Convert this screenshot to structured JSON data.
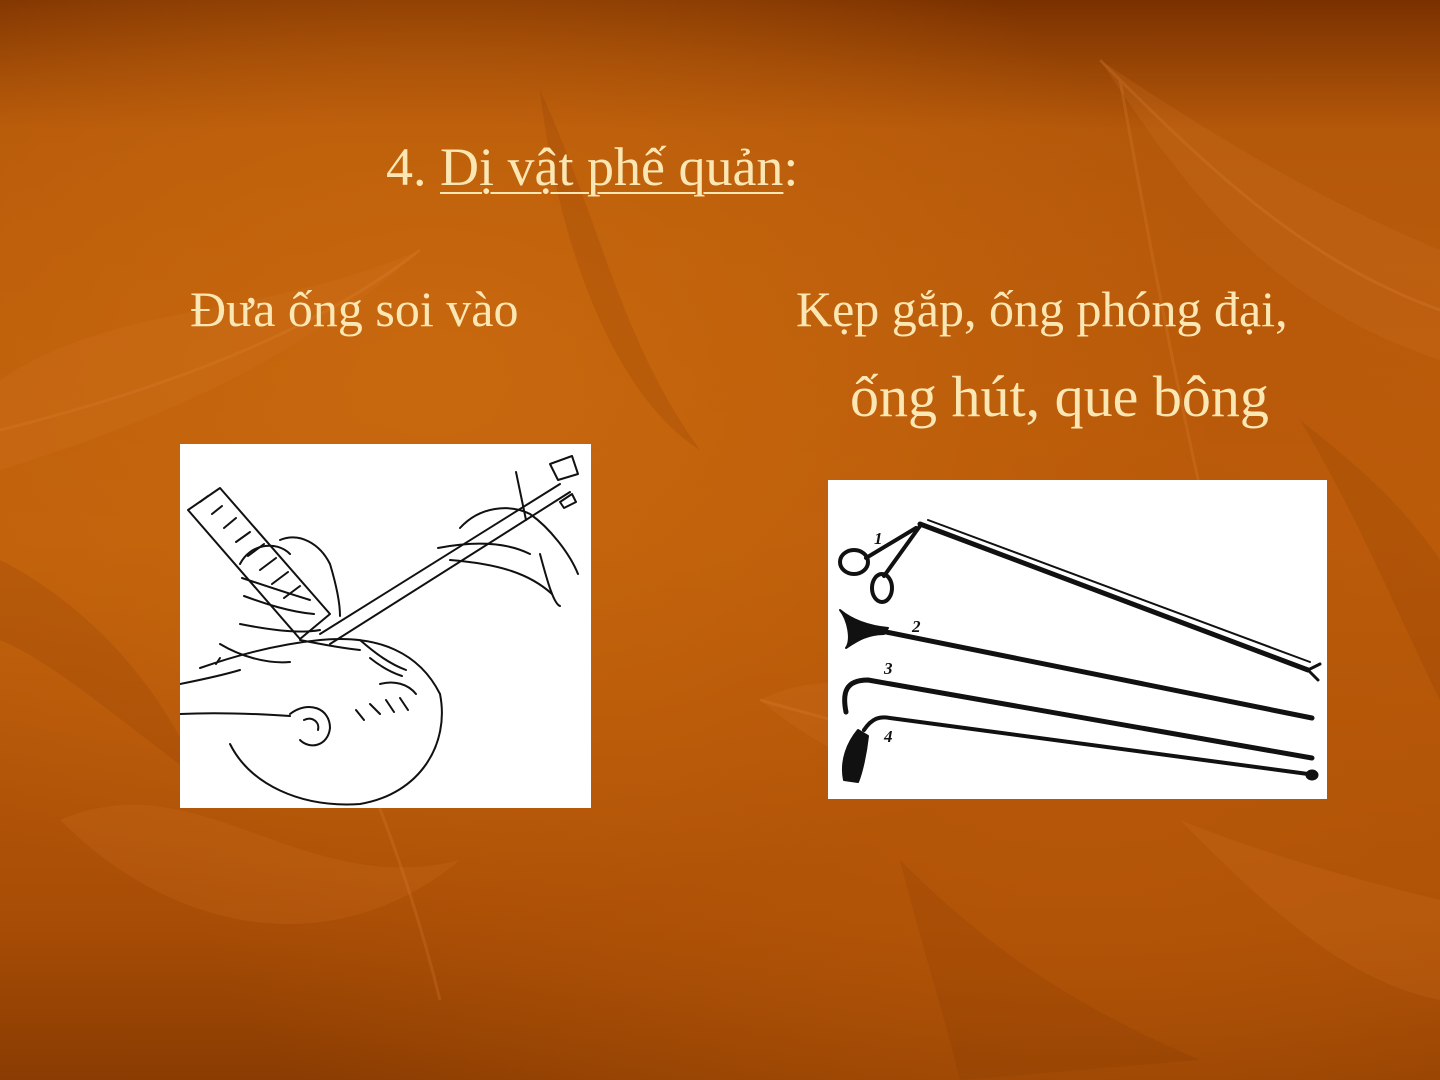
{
  "slide": {
    "title_prefix": "4. ",
    "title_underlined": "Dị vật phế quản",
    "title_suffix": ":",
    "caption_left": "Đưa ống soi vào",
    "caption_right_line1": "Kẹp gắp, ống phóng đại,",
    "caption_right_line2": "ống hút, que bông"
  },
  "instrument_labels": [
    "1",
    "2",
    "3",
    "4"
  ],
  "colors": {
    "background": "#bf5f0c",
    "text": "#fbe7b3"
  }
}
